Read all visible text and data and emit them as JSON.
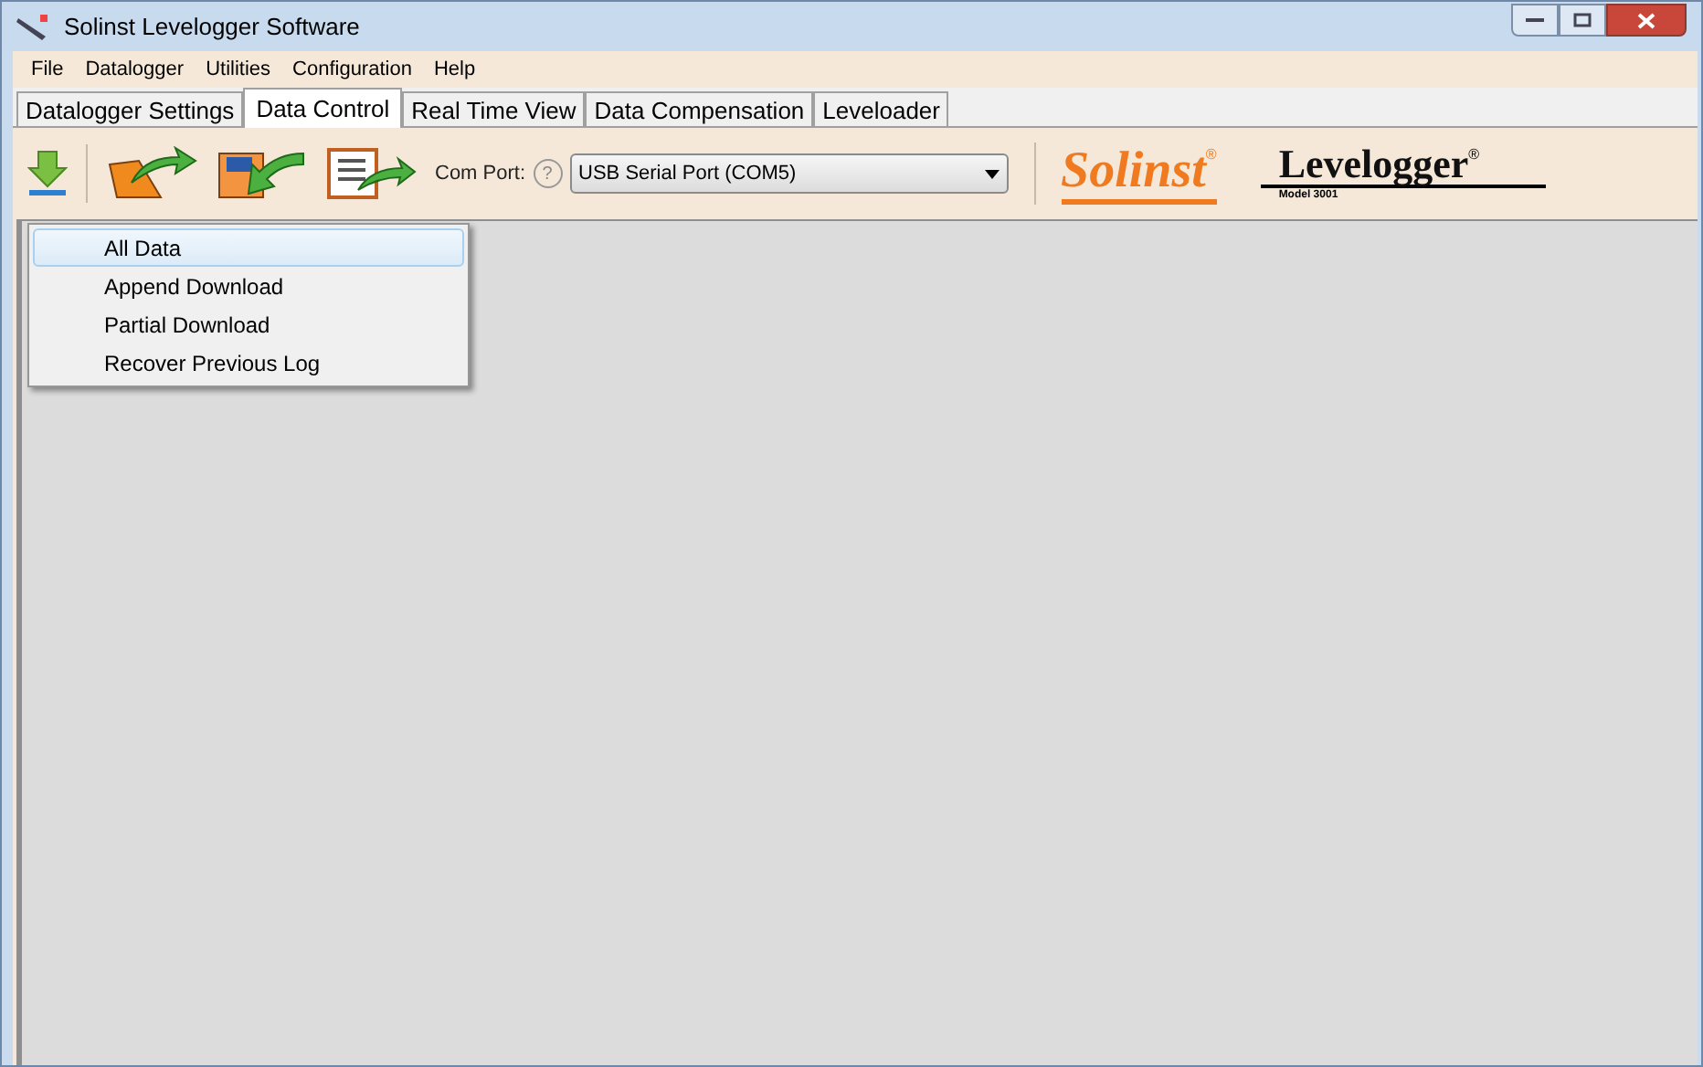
{
  "window": {
    "title": "Solinst Levelogger Software"
  },
  "menu": [
    "File",
    "Datalogger",
    "Utilities",
    "Configuration",
    "Help"
  ],
  "tabs": [
    {
      "label": "Datalogger Settings",
      "selected": false
    },
    {
      "label": "Data Control",
      "selected": true
    },
    {
      "label": "Real Time View",
      "selected": false
    },
    {
      "label": "Data Compensation",
      "selected": false
    },
    {
      "label": "Leveloader",
      "selected": false
    }
  ],
  "toolbar": {
    "com_port_label": "Com Port:",
    "help_glyph": "?",
    "com_port": "USB Serial Port (COM5)"
  },
  "logos": {
    "brand": "Solinst",
    "registered": "®",
    "product": "Levelogger",
    "product_mark": "®",
    "model": "Model 3001"
  },
  "dropdown_menu": [
    {
      "label": "All Data",
      "selected": true
    },
    {
      "label": "Append Download",
      "selected": false
    },
    {
      "label": "Partial Download",
      "selected": false
    },
    {
      "label": "Recover Previous Log",
      "selected": false
    }
  ]
}
